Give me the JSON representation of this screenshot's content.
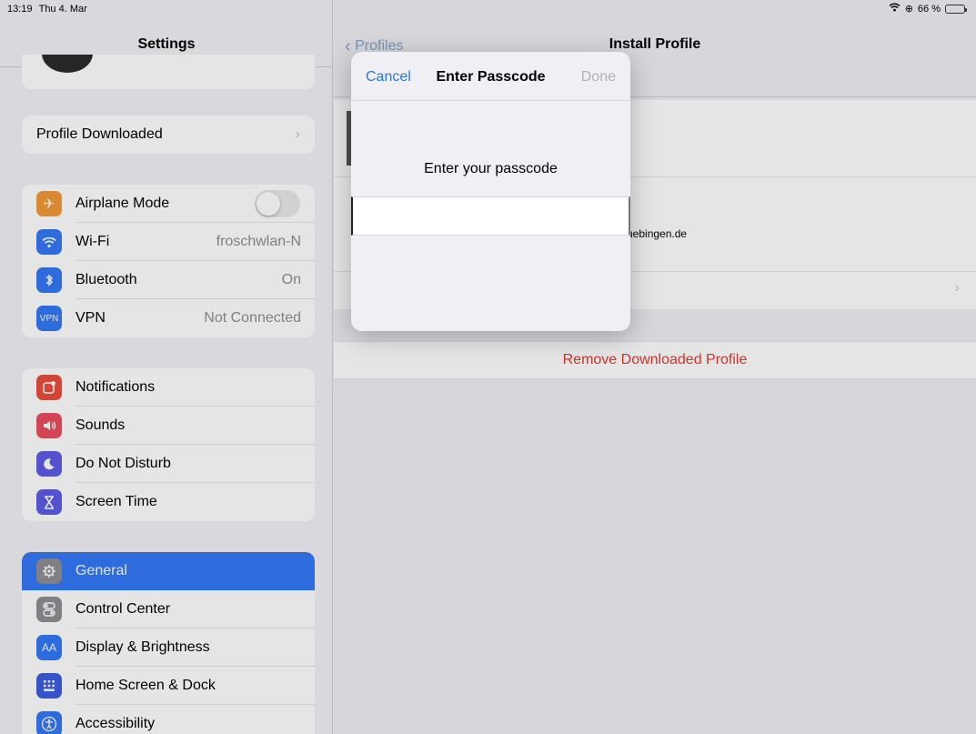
{
  "status": {
    "time": "13:19",
    "date": "Thu 4. Mar",
    "battery": "66 %",
    "battery_level": 0.66
  },
  "sidebar": {
    "title": "Settings",
    "profile_row": {
      "label": "Profile Downloaded"
    },
    "connectivity": [
      {
        "label": "Airplane Mode",
        "icon": "airplane-icon",
        "color": "#f09a37",
        "toggle": false
      },
      {
        "label": "Wi-Fi",
        "icon": "wifi-icon",
        "color": "#3478f6",
        "value": "froschwlan-N"
      },
      {
        "label": "Bluetooth",
        "icon": "bluetooth-icon",
        "color": "#3478f6",
        "value": "On"
      },
      {
        "label": "VPN",
        "icon": "vpn-icon",
        "icon_text": "VPN",
        "color": "#3478f6",
        "value": "Not Connected"
      }
    ],
    "system": [
      {
        "label": "Notifications",
        "icon": "notifications-icon",
        "color": "#eb4d3d"
      },
      {
        "label": "Sounds",
        "icon": "sounds-icon",
        "color": "#eb4d5f"
      },
      {
        "label": "Do Not Disturb",
        "icon": "moon-icon",
        "color": "#5e5ce6"
      },
      {
        "label": "Screen Time",
        "icon": "hourglass-icon",
        "color": "#5e5ce6"
      }
    ],
    "general": [
      {
        "label": "General",
        "icon": "gear-icon",
        "color": "#8e8e93",
        "selected": true
      },
      {
        "label": "Control Center",
        "icon": "switches-icon",
        "color": "#8e8e93"
      },
      {
        "label": "Display & Brightness",
        "icon": "display-icon",
        "icon_text": "AA",
        "color": "#3478f6"
      },
      {
        "label": "Home Screen & Dock",
        "icon": "grid-icon",
        "color": "#3d5ee0"
      },
      {
        "label": "Accessibility",
        "icon": "accessibility-icon",
        "color": "#3478f6"
      }
    ]
  },
  "detail": {
    "back_label": "Profiles",
    "title": "Install Profile",
    "domain_fragment": "uebingen.de",
    "remove_label": "Remove Downloaded Profile"
  },
  "modal": {
    "cancel_label": "Cancel",
    "title": "Enter Passcode",
    "done_label": "Done",
    "prompt": "Enter your passcode",
    "input_value": ""
  }
}
